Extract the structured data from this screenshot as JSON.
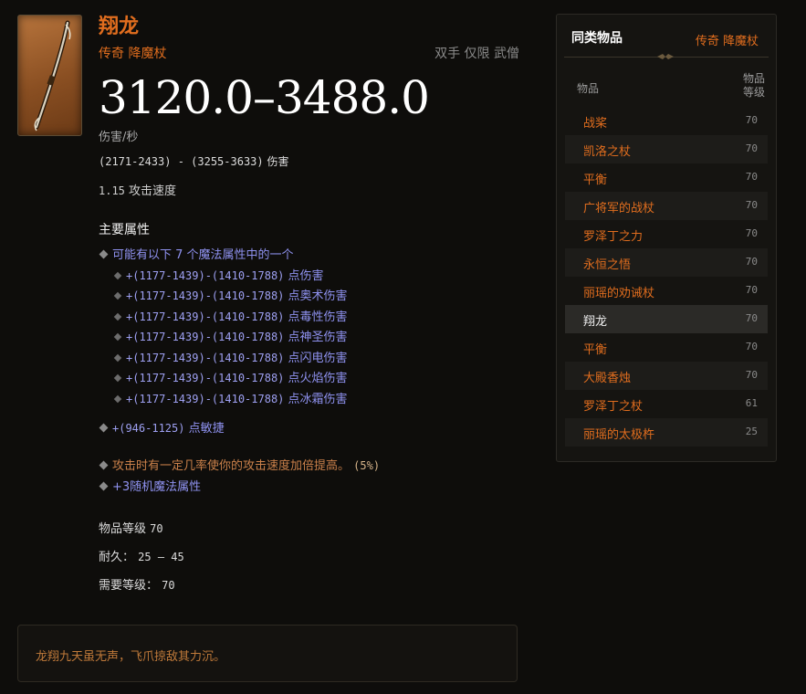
{
  "item": {
    "name": "翔龙",
    "type": "传奇 降魔杖",
    "slot": "双手 仅限 武僧",
    "dps": "3120.0–3488.0",
    "dps_label": "伤害/秒",
    "damage_range": "(2171-2433) - (3255-3633)",
    "damage_label": "伤害",
    "attack_speed_value": "1.15",
    "attack_speed_label": "攻击速度",
    "primary_title": "主要属性",
    "primary_intro": "可能有以下 7 个魔法属性中的一个",
    "primary_props": [
      {
        "value": "+(1177-1439)-(1410-1788)",
        "label": "点伤害"
      },
      {
        "value": "+(1177-1439)-(1410-1788)",
        "label": "点奥术伤害"
      },
      {
        "value": "+(1177-1439)-(1410-1788)",
        "label": "点毒性伤害"
      },
      {
        "value": "+(1177-1439)-(1410-1788)",
        "label": "点神圣伤害"
      },
      {
        "value": "+(1177-1439)-(1410-1788)",
        "label": "点闪电伤害"
      },
      {
        "value": "+(1177-1439)-(1410-1788)",
        "label": "点火焰伤害"
      },
      {
        "value": "+(1177-1439)-(1410-1788)",
        "label": "点冰霜伤害"
      }
    ],
    "dex_value": "+(946-1125)",
    "dex_label": "点敏捷",
    "legendary_prop": "攻击时有一定几率使你的攻击速度加倍提高。",
    "legendary_prop_value": "(5%)",
    "random_prop": "+3随机魔法属性",
    "item_level_label": "物品等级",
    "item_level_value": "70",
    "durability_label": "耐久：",
    "durability_value": "25 – 45",
    "req_level_label": "需要等级：",
    "req_level_value": "70",
    "flavor": "龙翔九天虽无声，飞爪掠敌其力沉。"
  },
  "side": {
    "title": "同类物品",
    "type": "传奇 降魔杖",
    "col_item": "物品",
    "col_level_1": "物品",
    "col_level_2": "等级",
    "rows": [
      {
        "name": "战桨",
        "level": "70"
      },
      {
        "name": "凯洛之杖",
        "level": "70"
      },
      {
        "name": "平衡",
        "level": "70"
      },
      {
        "name": "广将军的战杖",
        "level": "70"
      },
      {
        "name": "罗泽丁之力",
        "level": "70"
      },
      {
        "name": "永恒之悟",
        "level": "70"
      },
      {
        "name": "丽瑶的劝诫杖",
        "level": "70"
      },
      {
        "name": "翔龙",
        "level": "70"
      },
      {
        "name": "平衡",
        "level": "70"
      },
      {
        "name": "大殿香烛",
        "level": "70"
      },
      {
        "name": "罗泽丁之杖",
        "level": "61"
      },
      {
        "name": "丽瑶的太极杵",
        "level": "25"
      }
    ],
    "active_index": 7
  }
}
